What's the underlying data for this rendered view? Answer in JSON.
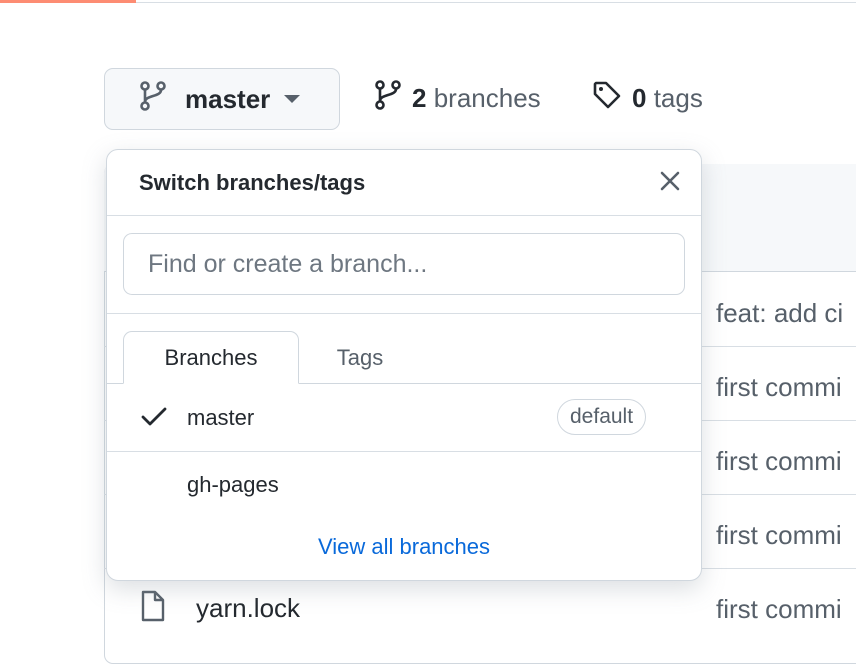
{
  "branch_button": {
    "label": "master"
  },
  "meta": {
    "branches_count": "2",
    "branches_label": "branches",
    "tags_count": "0",
    "tags_label": "tags"
  },
  "background": {
    "commits": [
      "feat: add ci",
      "first commi",
      "first commi",
      "first commi",
      "first commi"
    ],
    "file_name": "yarn.lock"
  },
  "dropdown": {
    "title": "Switch branches/tags",
    "filter_placeholder": "Find or create a branch...",
    "tabs": [
      {
        "label": "Branches",
        "active": true
      },
      {
        "label": "Tags",
        "active": false
      }
    ],
    "items": [
      {
        "label": "master",
        "selected": true,
        "badge": "default"
      },
      {
        "label": "gh-pages",
        "selected": false
      }
    ],
    "view_all": "View all branches"
  },
  "colors": {
    "accent": "#fd8c73",
    "link": "#0969da",
    "border": "#d0d7de"
  },
  "icons": [
    "git-branch-icon",
    "caret-down-icon",
    "tag-icon",
    "close-icon",
    "check-icon",
    "file-icon"
  ]
}
